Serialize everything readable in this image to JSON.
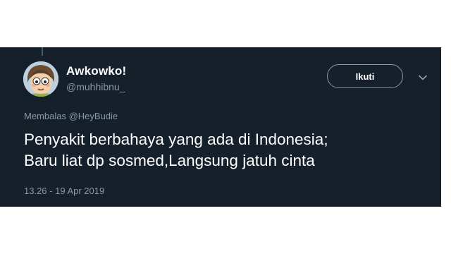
{
  "tweet": {
    "display_name": "Awkowko!",
    "username": "@muhhibnu_",
    "follow_label": "Ikuti",
    "reply_context": "Membalas @HeyBudie",
    "text_lines": [
      "Penyakit berbahaya yang ada di Indonesia;",
      "Baru liat dp sosmed,Langsung jatuh cinta"
    ],
    "timestamp": "13.26 - 19 Apr 2019"
  },
  "icons": {
    "avatar": "cartoon-face-avatar",
    "more": "chevron-down-icon"
  },
  "colors": {
    "card_background": "#15202b",
    "primary_text": "#ffffff",
    "secondary_text": "#8899a6"
  }
}
